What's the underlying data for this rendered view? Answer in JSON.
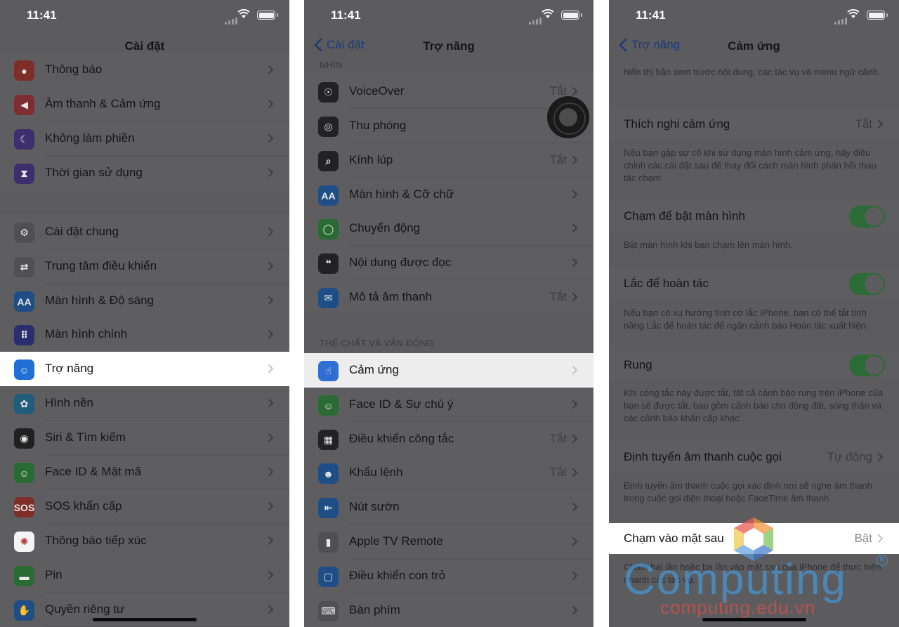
{
  "status": {
    "time": "11:41"
  },
  "panel1": {
    "title": "Cài đặt",
    "items": [
      {
        "label": "Thông báo",
        "icon": "notification-icon",
        "color": "#7e2d27"
      },
      {
        "label": "Âm thanh & Cảm ứng",
        "icon": "sound-icon",
        "color": "#7e2d33"
      },
      {
        "label": "Không làm phiền",
        "icon": "moon-icon",
        "color": "#3b2f6e"
      },
      {
        "label": "Thời gian sử dụng",
        "icon": "hourglass-icon",
        "color": "#3b2f6e"
      },
      {
        "label": "Cài đặt chung",
        "icon": "gear-icon",
        "color": "#505052"
      },
      {
        "label": "Trung tâm điều khiển",
        "icon": "toggles-icon",
        "color": "#505052"
      },
      {
        "label": "Màn hình & Độ sáng",
        "icon": "text-size-icon",
        "color": "#1f4e86"
      },
      {
        "label": "Màn hình chính",
        "icon": "home-grid-icon",
        "color": "#2a2e6e"
      },
      {
        "label": "Trợ năng",
        "icon": "accessibility-icon",
        "color": "#1f6fd6"
      },
      {
        "label": "Hình nền",
        "icon": "flower-icon",
        "color": "#1e5e7a"
      },
      {
        "label": "Siri & Tìm kiếm",
        "icon": "siri-icon",
        "color": "#202020"
      },
      {
        "label": "Face ID & Mật mã",
        "icon": "face-id-icon",
        "color": "#2a6b34"
      },
      {
        "label": "SOS khẩn cấp",
        "icon": "sos-icon",
        "color": "#7e2d27",
        "icon_text": "SOS"
      },
      {
        "label": "Thông báo tiếp xúc",
        "icon": "exposure-icon",
        "color": "#f4f4f4"
      },
      {
        "label": "Pin",
        "icon": "battery-icon",
        "color": "#2a6b34"
      },
      {
        "label": "Quyền riêng tư",
        "icon": "hand-icon",
        "color": "#1f4e86"
      }
    ]
  },
  "panel2": {
    "back": "Cài đặt",
    "title": "Trợ năng",
    "section_vision": "NHÌN",
    "section_physical": "THỂ CHẤT VÀ VẬN ĐỘNG",
    "vision_items": [
      {
        "label": "VoiceOver",
        "value": "Tắt",
        "icon": "voiceover-icon",
        "color": "#222224"
      },
      {
        "label": "Thu phóng",
        "value": "",
        "icon": "zoom-icon",
        "color": "#222224"
      },
      {
        "label": "Kính lúp",
        "value": "Tắt",
        "icon": "magnifier-icon",
        "color": "#222224"
      },
      {
        "label": "Màn hình & Cỡ chữ",
        "value": "",
        "icon": "text-size-icon",
        "color": "#1f4e86",
        "icon_text": "AA"
      },
      {
        "label": "Chuyển động",
        "value": "",
        "icon": "motion-icon",
        "color": "#2a6b34"
      },
      {
        "label": "Nội dung được đọc",
        "value": "",
        "icon": "spoken-icon",
        "color": "#222224"
      },
      {
        "label": "Mô tả âm thanh",
        "value": "Tắt",
        "icon": "audio-desc-icon",
        "color": "#1f4e86"
      }
    ],
    "physical_items": [
      {
        "label": "Cảm ứng",
        "value": "",
        "icon": "touch-icon",
        "color": "#2f6fd3"
      },
      {
        "label": "Face ID & Sự chú ý",
        "value": "",
        "icon": "face-id-icon",
        "color": "#2a6b34"
      },
      {
        "label": "Điều khiển công tắc",
        "value": "Tắt",
        "icon": "switch-control-icon",
        "color": "#222224"
      },
      {
        "label": "Khẩu lệnh",
        "value": "Tắt",
        "icon": "voice-control-icon",
        "color": "#1f4e86"
      },
      {
        "label": "Nút sườn",
        "value": "",
        "icon": "side-button-icon",
        "color": "#1f4e86"
      },
      {
        "label": "Apple TV Remote",
        "value": "",
        "icon": "remote-icon",
        "color": "#505052"
      },
      {
        "label": "Điều khiển con trỏ",
        "value": "",
        "icon": "pointer-icon",
        "color": "#1f4e86"
      },
      {
        "label": "Bàn phím",
        "value": "",
        "icon": "keyboard-icon",
        "color": "#505052"
      }
    ]
  },
  "panel3": {
    "back": "Trợ năng",
    "title": "Cảm ứng",
    "top_desc": "hiển thị bản xem trước nội dung, các tác vụ và menu ngữ cảnh.",
    "touch_accommodations": {
      "label": "Thích nghi cảm ứng",
      "value": "Tắt",
      "desc": "Nếu bạn gặp sự cố khi sử dụng màn hình cảm ứng, hãy điều chỉnh các cài đặt sau để thay đổi cách màn hình phản hồi thao tác chạm."
    },
    "tap_to_wake": {
      "label": "Chạm để bật màn hình",
      "desc": "Bật màn hình khi bạn chạm lên màn hình."
    },
    "shake_to_undo": {
      "label": "Lắc để hoàn tác",
      "desc": "Nếu bạn có xu hướng tình cờ lắc iPhone, bạn có thể tắt tính năng Lắc để hoàn tác để ngăn cảnh báo Hoàn tác xuất hiện."
    },
    "vibration": {
      "label": "Rung",
      "desc": "Khi công tắc này được tắt, tất cả cảnh báo rung trên iPhone của bạn sẽ được tắt, bao gồm cảnh báo cho động đất, sóng thần và các cảnh báo khẩn cấp khác."
    },
    "call_audio": {
      "label": "Định tuyến âm thanh cuộc gọi",
      "value": "Tự động",
      "desc": "Định tuyến âm thanh cuộc gọi xác định nơi sẽ nghe âm thanh trong cuộc gọi điện thoại hoặc FaceTime âm thanh."
    },
    "back_tap": {
      "label": "Chạm vào mặt sau",
      "value": "Bật",
      "desc": "Chạm hai lần hoặc ba lần vào mặt sau của iPhone để thực hiện nhanh các tác vụ."
    }
  },
  "watermark": {
    "brand": "Computing",
    "url": "computing.edu.vn",
    "reg": "R"
  }
}
